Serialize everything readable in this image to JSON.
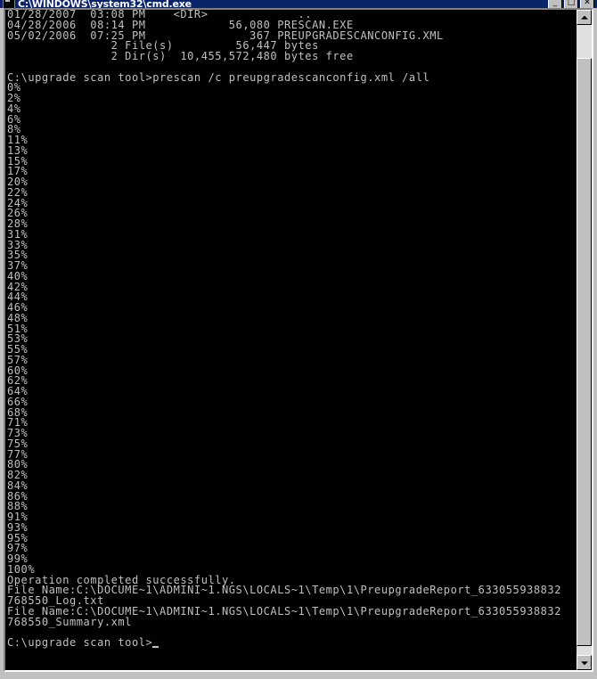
{
  "window": {
    "title": "C:\\WINDOWS\\system32\\cmd.exe",
    "icon": "console-icon",
    "buttons": {
      "minimize": "_",
      "maximize": "□",
      "close": "✕"
    }
  },
  "console": {
    "text_color": "#c0c0c0",
    "background_color": "#000000",
    "dir_listing": [
      "01/28/2007  03:08 PM    <DIR>             ..",
      "04/28/2006  08:14 PM            56,080 PRESCAN.EXE",
      "05/02/2006  07:25 PM               367 PREUPGRADESCANCONFIG.XML",
      "               2 File(s)         56,447 bytes",
      "               2 Dir(s)  10,455,572,480 bytes free"
    ],
    "blank_line": "",
    "command_line": "C:\\upgrade scan tool>prescan /c preupgradescanconfig.xml /all",
    "progress_percentages": [
      "0%",
      "2%",
      "4%",
      "6%",
      "8%",
      "11%",
      "13%",
      "15%",
      "17%",
      "20%",
      "22%",
      "24%",
      "26%",
      "28%",
      "31%",
      "33%",
      "35%",
      "37%",
      "40%",
      "42%",
      "44%",
      "46%",
      "48%",
      "51%",
      "53%",
      "55%",
      "57%",
      "60%",
      "62%",
      "64%",
      "66%",
      "68%",
      "71%",
      "73%",
      "75%",
      "77%",
      "80%",
      "82%",
      "84%",
      "86%",
      "88%",
      "91%",
      "93%",
      "95%",
      "97%",
      "99%",
      "100%"
    ],
    "result_message": "Operation completed successfully.",
    "log_file_line": "File Name:C:\\DOCUME~1\\ADMINI~1.NGS\\LOCALS~1\\Temp\\1\\PreupgradeReport_633055938832768550_Log.txt",
    "summary_file_line": "File Name:C:\\DOCUME~1\\ADMINI~1.NGS\\LOCALS~1\\Temp\\1\\PreupgradeReport_633055938832768550_Summary.xml",
    "prompt": "C:\\upgrade scan tool>",
    "cursor": "_"
  },
  "scrollbar": {
    "up_arrow": "▲",
    "down_arrow": "▼",
    "thumb_label": "scroll-thumb"
  }
}
